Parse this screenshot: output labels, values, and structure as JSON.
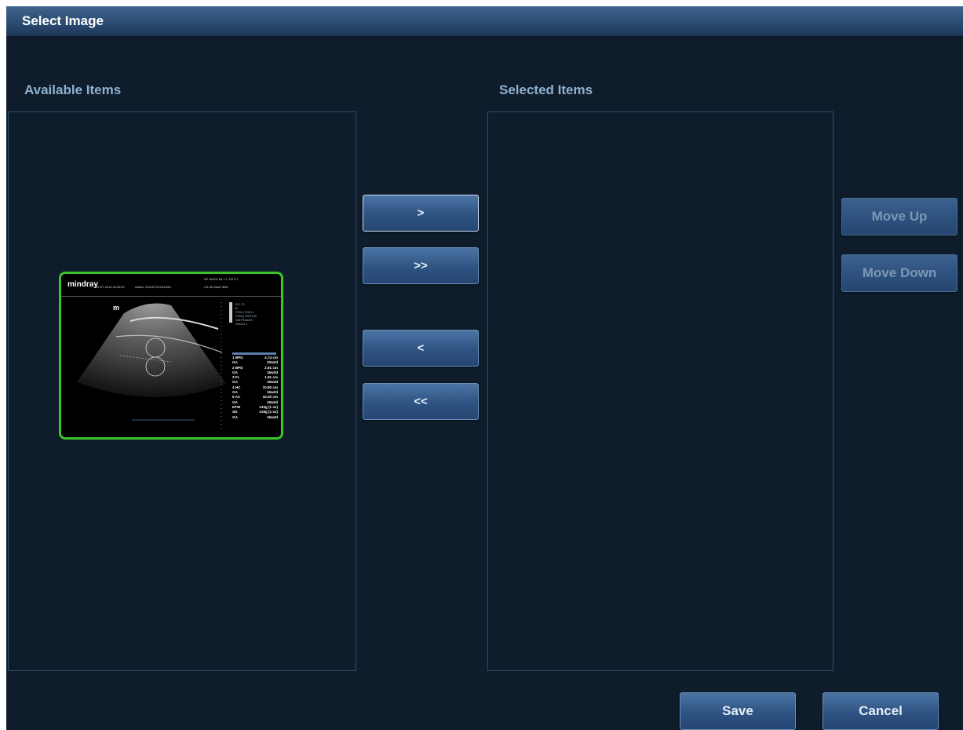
{
  "dialog": {
    "title": "Select Image"
  },
  "available": {
    "label": "Available Items",
    "thumbnail": {
      "logo": "mindray",
      "header_date": "22-07-2014 04:06:37",
      "header_user": "Admin",
      "header_id": "20140723-041050-",
      "header_right_1": "AP 96.8%  MI 1.1  TIS 0.7",
      "header_right_2": "C5-2E   Adult NBO",
      "m_marker": "m",
      "params": [
        "DC-70",
        "B",
        "FH5.0   D15.0",
        "FREQ   2DR130",
        "GN   Persist3",
        "Gleam 1"
      ],
      "measurements": [
        {
          "label": "1 BPD",
          "value": "4.74 cm"
        },
        {
          "label": "GA",
          "value": "20w2d"
        },
        {
          "label": "2 BPD",
          "value": "2.91 cm"
        },
        {
          "label": "GA",
          "value": "15w3d"
        },
        {
          "label": "3 FL",
          "value": "1.91 cm"
        },
        {
          "label": "GA",
          "value": "15w3d"
        },
        {
          "label": "4 HC",
          "value": "10.80 cm"
        },
        {
          "label": "GA",
          "value": "15w2d"
        },
        {
          "label": "5 AC",
          "value": "10.20 cm"
        },
        {
          "label": "GA",
          "value": "16w2d"
        },
        {
          "label": "EFW",
          "value": "133g (1 oz)"
        },
        {
          "label": "SD",
          "value": "±19g (1 oz)"
        },
        {
          "label": "GA",
          "value": "15w4d"
        }
      ]
    }
  },
  "selected": {
    "label": "Selected Items"
  },
  "transfer_buttons": {
    "add": ">",
    "add_all": ">>",
    "remove": "<",
    "remove_all": "<<"
  },
  "order_buttons": {
    "move_up": "Move Up",
    "move_down": "Move Down"
  },
  "footer": {
    "save": "Save",
    "cancel": "Cancel"
  }
}
